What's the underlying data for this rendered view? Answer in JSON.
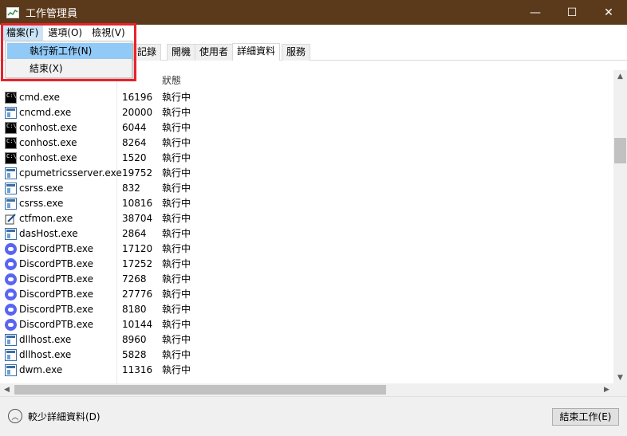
{
  "window": {
    "title": "工作管理員",
    "controls": {
      "minimize": "—",
      "maximize": "☐",
      "close": "✕"
    }
  },
  "menubar": {
    "items": [
      {
        "label": "檔案(F)"
      },
      {
        "label": "選項(O)"
      },
      {
        "label": "檢視(V)"
      }
    ]
  },
  "file_menu": {
    "items": [
      {
        "label": "執行新工作(N)"
      },
      {
        "label": "結束(X)"
      }
    ]
  },
  "tabs": [
    {
      "label": "記錄"
    },
    {
      "label": "開機"
    },
    {
      "label": "使用者"
    },
    {
      "label": "詳細資料"
    },
    {
      "label": "服務"
    }
  ],
  "table": {
    "columns": {
      "status": "狀態"
    },
    "rows": [
      {
        "icon": "cmd-icon",
        "name": "cmd.exe",
        "pid": "16196",
        "status": "執行中"
      },
      {
        "icon": "window-icon",
        "name": "cncmd.exe",
        "pid": "20000",
        "status": "執行中"
      },
      {
        "icon": "cmd-icon",
        "name": "conhost.exe",
        "pid": "6044",
        "status": "執行中"
      },
      {
        "icon": "cmd-icon",
        "name": "conhost.exe",
        "pid": "8264",
        "status": "執行中"
      },
      {
        "icon": "cmd-icon",
        "name": "conhost.exe",
        "pid": "1520",
        "status": "執行中"
      },
      {
        "icon": "window-icon",
        "name": "cpumetricsserver.exe",
        "pid": "19752",
        "status": "執行中"
      },
      {
        "icon": "window-icon",
        "name": "csrss.exe",
        "pid": "832",
        "status": "執行中"
      },
      {
        "icon": "window-icon",
        "name": "csrss.exe",
        "pid": "10816",
        "status": "執行中"
      },
      {
        "icon": "pen-icon",
        "name": "ctfmon.exe",
        "pid": "38704",
        "status": "執行中"
      },
      {
        "icon": "window-icon",
        "name": "dasHost.exe",
        "pid": "2864",
        "status": "執行中"
      },
      {
        "icon": "discord-icon",
        "name": "DiscordPTB.exe",
        "pid": "17120",
        "status": "執行中"
      },
      {
        "icon": "discord-icon",
        "name": "DiscordPTB.exe",
        "pid": "17252",
        "status": "執行中"
      },
      {
        "icon": "discord-icon",
        "name": "DiscordPTB.exe",
        "pid": "7268",
        "status": "執行中"
      },
      {
        "icon": "discord-icon",
        "name": "DiscordPTB.exe",
        "pid": "27776",
        "status": "執行中"
      },
      {
        "icon": "discord-icon",
        "name": "DiscordPTB.exe",
        "pid": "8180",
        "status": "執行中"
      },
      {
        "icon": "discord-icon",
        "name": "DiscordPTB.exe",
        "pid": "10144",
        "status": "執行中"
      },
      {
        "icon": "window-icon",
        "name": "dllhost.exe",
        "pid": "8960",
        "status": "執行中"
      },
      {
        "icon": "window-icon",
        "name": "dllhost.exe",
        "pid": "5828",
        "status": "執行中"
      },
      {
        "icon": "window-icon",
        "name": "dwm.exe",
        "pid": "11316",
        "status": "執行中"
      }
    ]
  },
  "footer": {
    "fewer_details": "較少詳細資料(D)",
    "end_task": "結束工作(E)"
  },
  "colors": {
    "titlebar": "#5b3a1c",
    "menu_highlight": "#91c9f7",
    "annotation_box": "#e8232a",
    "discord": "#5865f2"
  }
}
